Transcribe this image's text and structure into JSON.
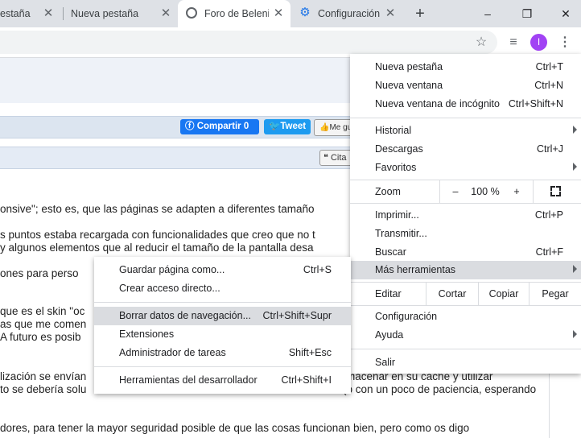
{
  "tabs": [
    {
      "label": "estaña"
    },
    {
      "label": "Nueva pestaña"
    },
    {
      "label": "Foro de Beleni"
    },
    {
      "label": "Configuración"
    }
  ],
  "window": {
    "minimize": "–",
    "restore": "❐",
    "close": "✕"
  },
  "toolbar": {
    "avatar_letter": "I"
  },
  "page": {
    "share_facebook": "Compartir 0",
    "share_twitter": "Tweet",
    "like_label": "Me gus",
    "quote_label": "Cita",
    "lines": [
      "onsive\"; esto es, que las páginas se adapten a diferentes tamaño",
      "s puntos estaba recargada con funcionalidades que creo que no t",
      "y algunos elementos que al reducir el tamaño de la pantalla desa",
      "ones para perso",
      "que es el skin \"oc",
      "as que me comen",
      "A futuro es posib",
      "lización se envían",
      "to se debería solu",
      "macenar en su caché y utilizar",
      "(o con un poco de paciencia, esperando",
      "dores, para tener la mayor seguridad posible de que las cosas funcionan bien, pero como os digo"
    ]
  },
  "menu": {
    "new_tab": {
      "label": "Nueva pestaña",
      "shortcut": "Ctrl+T"
    },
    "new_window": {
      "label": "Nueva ventana",
      "shortcut": "Ctrl+N"
    },
    "incognito": {
      "label": "Nueva ventana de incógnito",
      "shortcut": "Ctrl+Shift+N"
    },
    "history": {
      "label": "Historial"
    },
    "downloads": {
      "label": "Descargas",
      "shortcut": "Ctrl+J"
    },
    "bookmarks": {
      "label": "Favoritos"
    },
    "zoom": {
      "label": "Zoom",
      "minus": "–",
      "value": "100 %",
      "plus": "+"
    },
    "print": {
      "label": "Imprimir...",
      "shortcut": "Ctrl+P"
    },
    "cast": {
      "label": "Transmitir..."
    },
    "find": {
      "label": "Buscar",
      "shortcut": "Ctrl+F"
    },
    "more_tools": {
      "label": "Más herramientas"
    },
    "edit": {
      "label": "Editar",
      "cut": "Cortar",
      "copy": "Copiar",
      "paste": "Pegar"
    },
    "settings": {
      "label": "Configuración"
    },
    "help": {
      "label": "Ayuda"
    },
    "exit": {
      "label": "Salir"
    }
  },
  "submenu": {
    "save_page": {
      "label": "Guardar página como...",
      "shortcut": "Ctrl+S"
    },
    "create_shortcut": {
      "label": "Crear acceso directo..."
    },
    "clear_data": {
      "label": "Borrar datos de navegación...",
      "shortcut": "Ctrl+Shift+Supr"
    },
    "extensions": {
      "label": "Extensiones"
    },
    "task_manager": {
      "label": "Administrador de tareas",
      "shortcut": "Shift+Esc"
    },
    "dev_tools": {
      "label": "Herramientas del desarrollador",
      "shortcut": "Ctrl+Shift+I"
    }
  },
  "colors": {
    "accent": "#1a73e8",
    "avatar": "#a142f4",
    "highlight": "#dadce0"
  }
}
